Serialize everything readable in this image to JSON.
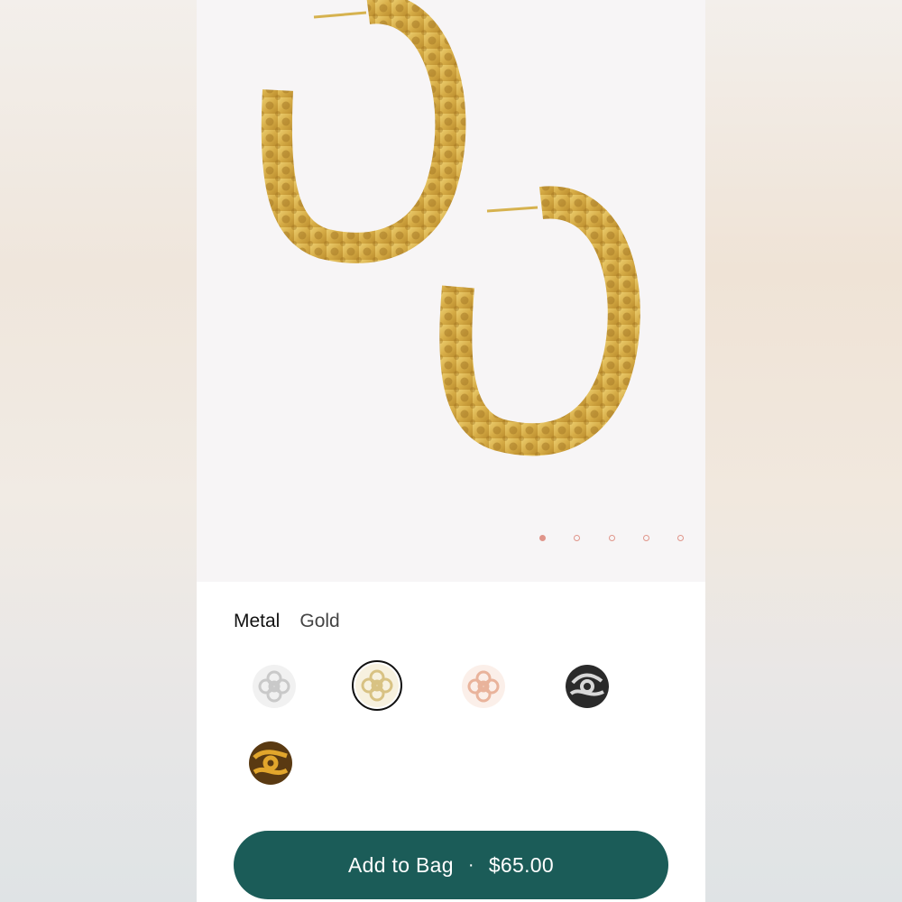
{
  "product": {
    "image_alt": "Gold filigree hoop earrings"
  },
  "carousel": {
    "slide_count": 5,
    "active_index": 0,
    "dot_color": "#e0958a"
  },
  "options": {
    "metal_label": "Metal",
    "metal_value": "Gold",
    "swatches": [
      {
        "name": "Rhodium",
        "icon": "silver-filigree-icon",
        "selected": false
      },
      {
        "name": "Gold",
        "icon": "gold-filigree-icon",
        "selected": true
      },
      {
        "name": "Rose Gold",
        "icon": "rose-gold-filigree-icon",
        "selected": false
      },
      {
        "name": "Gunmetal",
        "icon": "gunmetal-filigree-icon",
        "selected": false
      },
      {
        "name": "Vintage Gold",
        "icon": "vintage-gold-filigree-icon",
        "selected": false
      }
    ]
  },
  "cta": {
    "label": "Add to Bag",
    "separator": "·",
    "price": "$65.00",
    "color": "#1b5c58"
  }
}
